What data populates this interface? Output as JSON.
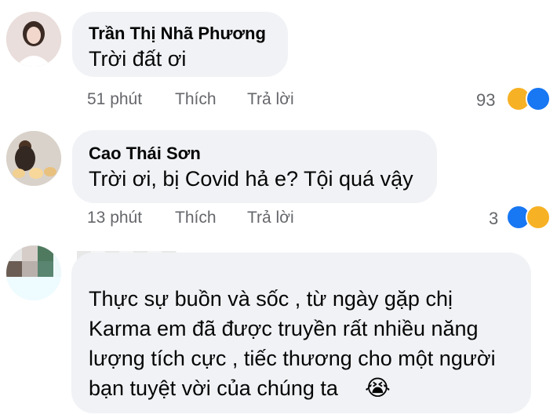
{
  "comments": [
    {
      "name": "Trần Thị Nhã Phương",
      "text": "Trời đất ơi",
      "time": "51 phút",
      "like": "Thích",
      "reply": "Trả lời",
      "reaction_count": "93"
    },
    {
      "name": "Cao Thái Sơn",
      "text": "Trời ơi, bị Covid hả e? Tội quá vậy",
      "time": "13 phút",
      "like": "Thích",
      "reply": "Trả lời",
      "reaction_count": "3"
    },
    {
      "lines": [
        "Thực sự buồn và sốc , từ ngày gặp chị",
        "Karma em đã được truyền rất nhiều năng",
        "lượng tích cực , tiếc thương cho một người",
        "bạn tuyệt vời của chúng ta"
      ],
      "emoji": "😭"
    }
  ],
  "colors": {
    "bubble": "#f0f2f5",
    "like_blue": "#1877f2",
    "sad_yellow": "#f7b125",
    "meta_gray": "#65676b"
  }
}
